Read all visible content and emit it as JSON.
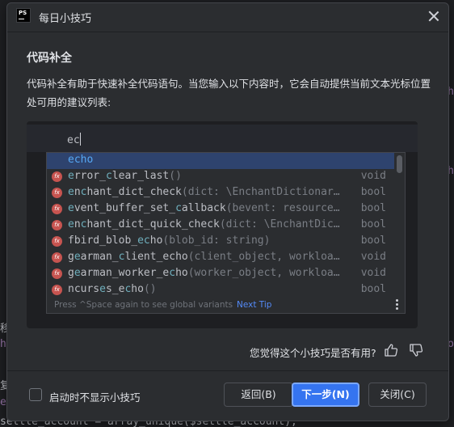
{
  "background": {
    "bottom_code": "settle_account = array_unique($settle_account);",
    "left_glyphs": [
      "移",
      "h",
      "复",
      "e"
    ],
    "right_glyphs": [
      "h",
      "h",
      "io"
    ]
  },
  "dialog": {
    "app_logo": "PS",
    "title": "每日小技巧",
    "heading": "代码补全",
    "description": "代码补全有助于快速补全代码语句。当您输入以下内容时，它会自动提供当前文本光标位置处可用的建议列表:",
    "preview": {
      "typed": "ec",
      "completions": [
        {
          "prefix": "",
          "match": "echo",
          "rest": "",
          "sig": "",
          "type": "",
          "selected": true,
          "icon": ""
        },
        {
          "prefix": "",
          "match": "e",
          "rest": "rror_",
          "match2": "c",
          "rest2": "lear_",
          "match3": "",
          "rest3": "",
          "tail": "last",
          "sig": "()",
          "type": "void",
          "icon": "fx"
        },
        {
          "prefix": "",
          "label": "enchant_dict_check",
          "sig": "(dict: \\EnchantDictionar…",
          "type": "bool",
          "icon": "fx"
        },
        {
          "prefix": "",
          "label": "event_buffer_set_callback",
          "sig": "(bevent: resource…",
          "type": "bool",
          "icon": "fx"
        },
        {
          "prefix": "",
          "label": "enchant_dict_quick_check",
          "sig": "(dict: \\EnchantDic…",
          "type": "bool",
          "icon": "fx"
        },
        {
          "prefix": "",
          "label": "fbird_blob_echo",
          "sig": "(blob_id: string)",
          "type": "bool",
          "icon": "fx"
        },
        {
          "prefix": "",
          "label": "gearman_client_echo",
          "sig": "(client_object, workloa…",
          "type": "void",
          "icon": "fx"
        },
        {
          "prefix": "",
          "label": "gearman_worker_echo",
          "sig": "(worker_object, workloa…",
          "type": "void",
          "icon": "fx"
        },
        {
          "prefix": "",
          "label": "ncurses_echo",
          "sig": "()",
          "type": "bool",
          "icon": "fx"
        }
      ],
      "footer_hint": "Press ^Space again to see global variants",
      "footer_link": "Next Tip"
    },
    "feedback_question": "您觉得这个小技巧是否有用?",
    "checkbox_label": "启动时不显示小技巧",
    "buttons": {
      "back": "返回(B)",
      "next": "下一步(N)",
      "close": "关闭(C)"
    }
  },
  "colors": {
    "accent": "#3574f0",
    "selection": "#2e436e",
    "fx_badge": "#c75450",
    "link": "#548af7"
  }
}
